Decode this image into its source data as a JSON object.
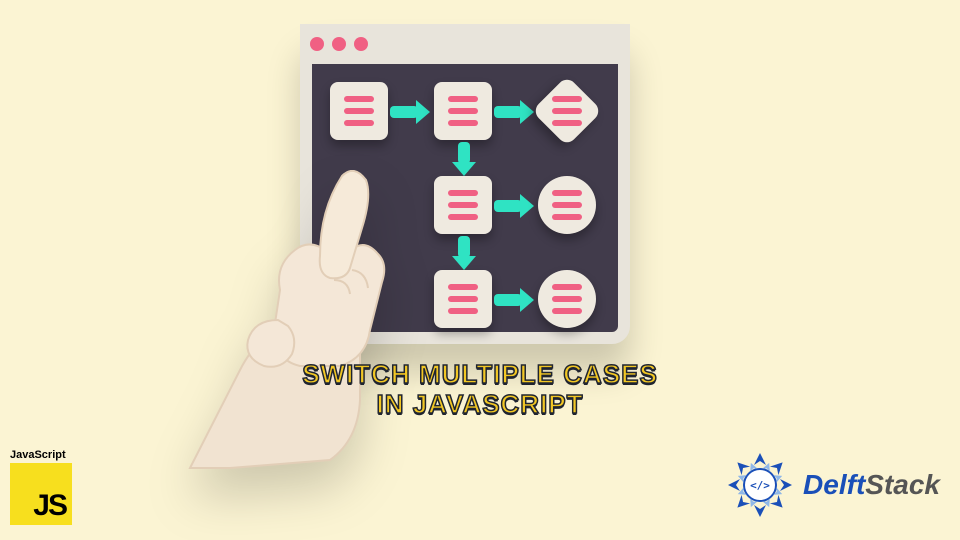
{
  "title_line1": "Switch Multiple Cases",
  "title_line2": "in Javascript",
  "js_badge": {
    "label": "JavaScript",
    "logo_text": "JS"
  },
  "delftstack": {
    "text_blue": "Delft",
    "text_gray": "Stack"
  },
  "colors": {
    "background": "#fbf4d3",
    "title_fill": "#f2c724",
    "title_stroke": "#1f2430",
    "window_border": "#e8e4db",
    "window_body": "#413b4b",
    "node_fill": "#efeae0",
    "node_bars": "#f06083",
    "arrow": "#2fe3c3",
    "dots": "#f06083",
    "js_yellow": "#f7df1e",
    "delft_blue": "#1a4fb8"
  }
}
